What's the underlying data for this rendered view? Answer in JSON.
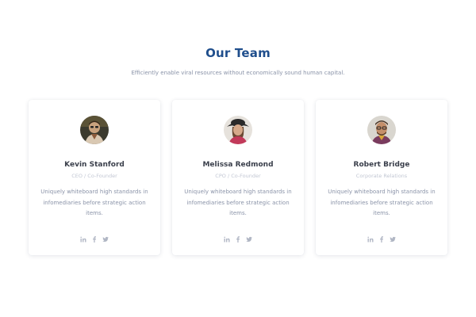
{
  "section": {
    "title": "Our Team",
    "subtitle": "Efficiently enable viral resources without economically sound human capital."
  },
  "members": [
    {
      "name": "Kevin Stanford",
      "role": "CEO / Co-Founder",
      "bio": "Uniquely whiteboard high standards in infomediaries before strategic action items.",
      "social": [
        "linkedin-icon",
        "facebook-icon",
        "twitter-icon"
      ]
    },
    {
      "name": "Melissa Redmond",
      "role": "CPO / Co-Founder",
      "bio": "Uniquely whiteboard high standards in infomediaries before strategic action items.",
      "social": [
        "linkedin-icon",
        "facebook-icon",
        "twitter-icon"
      ]
    },
    {
      "name": "Robert Bridge",
      "role": "Corporate Relations",
      "bio": "Uniquely whiteboard high standards in infomediaries before strategic action items.",
      "social": [
        "linkedin-icon",
        "facebook-icon",
        "twitter-icon"
      ]
    }
  ],
  "colors": {
    "title": "#1f4e8c",
    "text_muted": "#8a93a8",
    "role": "#c2c7d3",
    "icon": "#b0b6c4"
  }
}
